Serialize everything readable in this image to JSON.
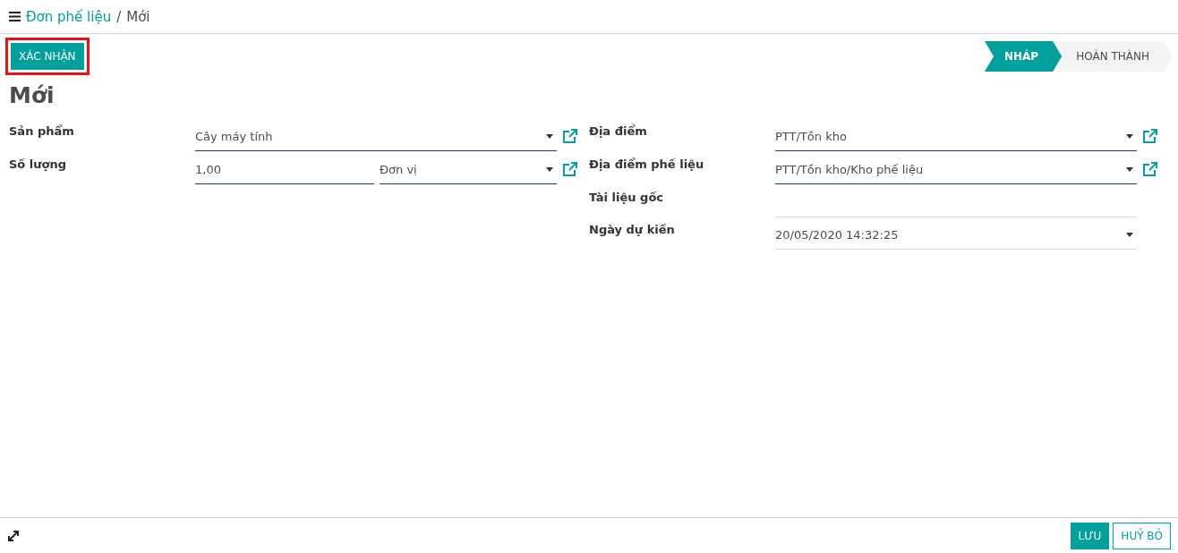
{
  "breadcrumb_separator": "/",
  "breadcrumb": [
    {
      "label": "Đơn phế liệu",
      "link": true
    },
    {
      "label": "Mới",
      "link": false
    }
  ],
  "actions": [
    {
      "label": "XÁC NHẬN",
      "highlighted": true
    }
  ],
  "stages": [
    {
      "label": "NHÁP",
      "selected": true
    },
    {
      "label": "HOÀN THÀNH",
      "selected": false
    }
  ],
  "title": "Mới",
  "left_fields": [
    {
      "label": "Sản phẩm",
      "kind": "many2one",
      "value": "Cây máy tính"
    },
    {
      "label": "Số lượng",
      "kind": "quantity",
      "value": "1,00",
      "unit": "Đơn vị"
    }
  ],
  "right_fields": [
    {
      "label": "Địa điểm",
      "kind": "many2one",
      "value": "PTT/Tồn kho"
    },
    {
      "label": "Địa điểm phế liệu",
      "kind": "many2one",
      "value": "PTT/Tồn kho/Kho phế liệu"
    },
    {
      "label": "Tài liệu gốc",
      "kind": "text"
    },
    {
      "label": "Ngày dự kiến",
      "kind": "date",
      "value": "20/05/2020 14:32:25"
    }
  ],
  "footer_buttons": [
    {
      "label": "LƯU",
      "primary": true
    },
    {
      "label": "HUỶ BỎ",
      "primary": false
    }
  ]
}
